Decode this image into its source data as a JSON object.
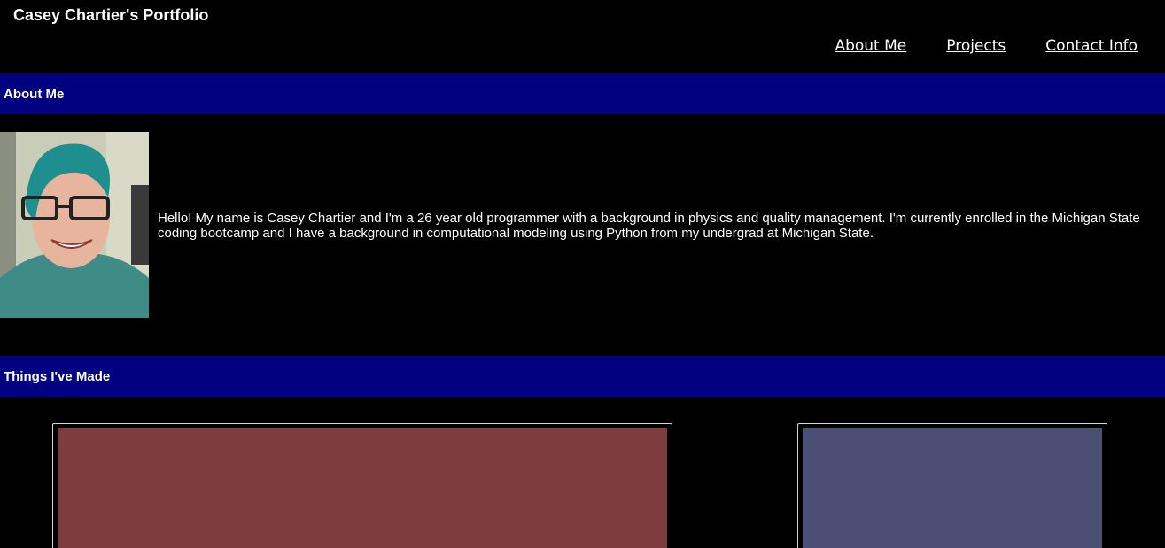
{
  "header": {
    "site_title": "Casey Chartier's Portfolio"
  },
  "nav": {
    "items": [
      {
        "label": "About Me"
      },
      {
        "label": "Projects"
      },
      {
        "label": "Contact Info"
      }
    ]
  },
  "about": {
    "heading": "About Me",
    "text": "Hello! My name is Casey Chartier and I'm a 26 year old programmer with a background in physics and quality management. I'm currently enrolled in the Michigan State coding bootcamp and I have a background in computational modeling using Python from my undergrad at Michigan State."
  },
  "things": {
    "heading": "Things I've Made"
  },
  "colors": {
    "section_bar": "#000080",
    "background": "#000000",
    "project_1_thumb": "#7d3c3f",
    "project_2_thumb": "#4a4f73"
  }
}
